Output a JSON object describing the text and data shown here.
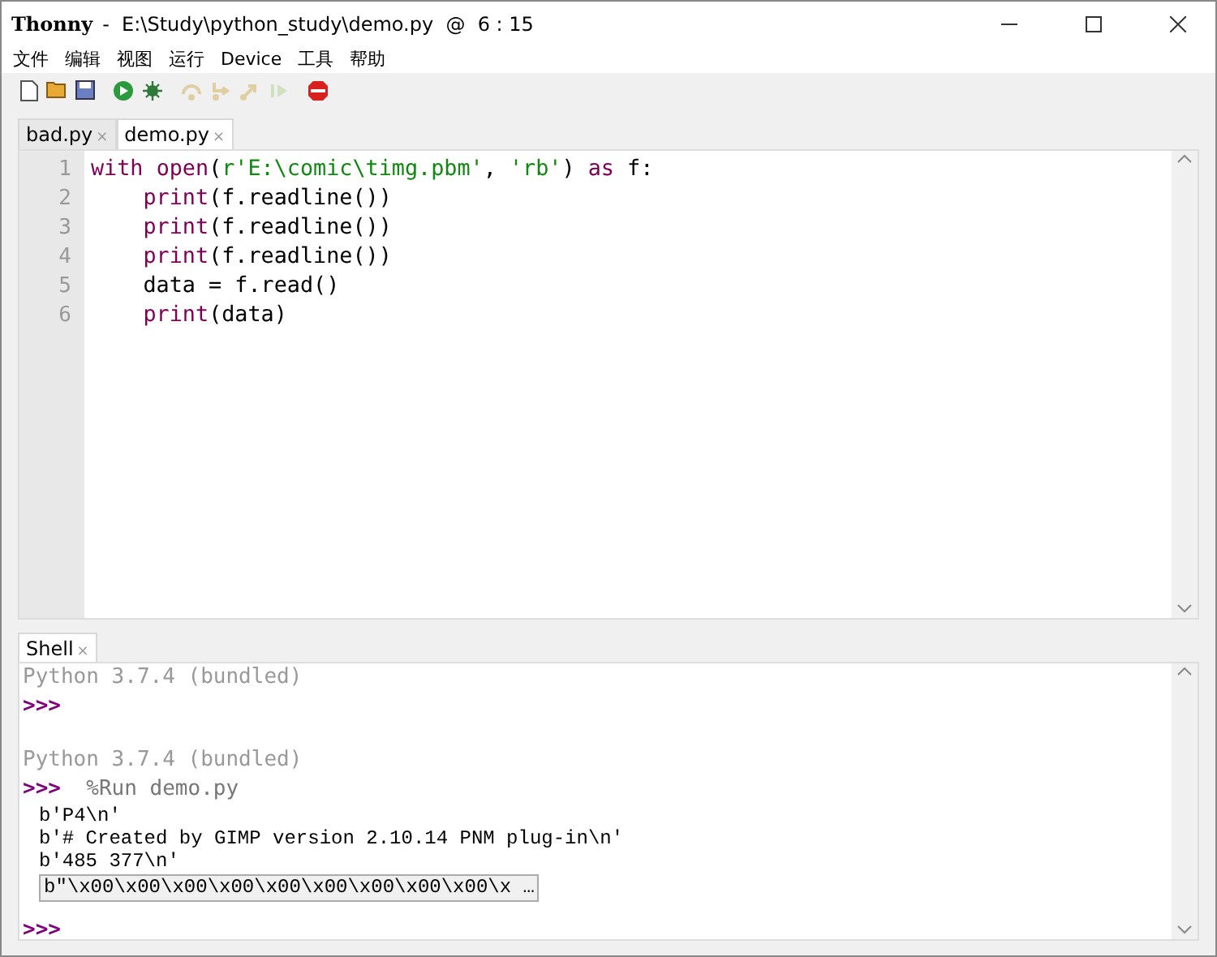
{
  "window": {
    "app": "Thonny",
    "title": "-  E:\\Study\\python_study\\demo.py  @  6 : 15"
  },
  "menu": [
    "文件",
    "编辑",
    "视图",
    "运行",
    "Device",
    "工具",
    "帮助"
  ],
  "toolbar": [
    {
      "kind": "new",
      "disabled": false
    },
    {
      "kind": "open",
      "disabled": false
    },
    {
      "kind": "save",
      "disabled": false
    },
    {
      "kind": "run",
      "disabled": false
    },
    {
      "kind": "debug",
      "disabled": false
    },
    {
      "kind": "step-over",
      "disabled": true
    },
    {
      "kind": "step-into",
      "disabled": true
    },
    {
      "kind": "step-out",
      "disabled": true
    },
    {
      "kind": "resume",
      "disabled": true
    },
    {
      "kind": "stop",
      "disabled": false
    }
  ],
  "editor_tabs": [
    {
      "label": "bad.py",
      "close": "×",
      "selected": false
    },
    {
      "label": "demo.py",
      "close": "×",
      "selected": true
    }
  ],
  "editor": {
    "lines": [
      {
        "number": "1",
        "tokens": [
          {
            "text": "with ",
            "kind": "keyword"
          },
          {
            "text": "open",
            "kind": "builtin"
          },
          {
            "text": "(",
            "kind": "plain"
          },
          {
            "text": "r'E:\\comic\\timg.pbm'",
            "kind": "string"
          },
          {
            "text": ", ",
            "kind": "plain"
          },
          {
            "text": "'rb'",
            "kind": "string"
          },
          {
            "text": ") ",
            "kind": "plain"
          },
          {
            "text": "as",
            "kind": "keyword"
          },
          {
            "text": " f:",
            "kind": "plain"
          }
        ]
      },
      {
        "number": "2",
        "tokens": [
          {
            "text": "    print",
            "kind": "builtin"
          },
          {
            "text": "(f.readline())",
            "kind": "plain"
          }
        ]
      },
      {
        "number": "3",
        "tokens": [
          {
            "text": "    print",
            "kind": "builtin"
          },
          {
            "text": "(f.readline())",
            "kind": "plain"
          }
        ]
      },
      {
        "number": "4",
        "tokens": [
          {
            "text": "    print",
            "kind": "builtin"
          },
          {
            "text": "(f.readline())",
            "kind": "plain"
          }
        ]
      },
      {
        "number": "5",
        "tokens": [
          {
            "text": "    data = f.read()",
            "kind": "plain"
          }
        ]
      },
      {
        "number": "6",
        "tokens": [
          {
            "text": "    print",
            "kind": "builtin"
          },
          {
            "text": "(data)",
            "kind": "plain"
          }
        ]
      }
    ]
  },
  "shell_tab": {
    "label": "Shell",
    "close": "×",
    "selected": true
  },
  "shell": [
    {
      "kind": "banner",
      "text": "Python 3.7.4 (bundled)"
    },
    {
      "kind": "prompt",
      "prompt": ">>>"
    },
    {
      "kind": "separator"
    },
    {
      "kind": "banner",
      "text": "Python 3.7.4 (bundled)"
    },
    {
      "kind": "prompt",
      "prompt": ">>>",
      "command": "%Run demo.py"
    },
    {
      "kind": "output",
      "text": "b'P4\\n'"
    },
    {
      "kind": "output",
      "text": "b'# Created by GIMP version 2.10.14 PNM plug-in\\n'"
    },
    {
      "kind": "output",
      "text": "b'485 377\\n'"
    },
    {
      "kind": "truncated",
      "text": "b\"\\x00\\x00\\x00\\x00\\x00\\x00\\x00\\x00\\x00\\x …"
    },
    {
      "kind": "prompt",
      "prompt": ">>>"
    }
  ]
}
